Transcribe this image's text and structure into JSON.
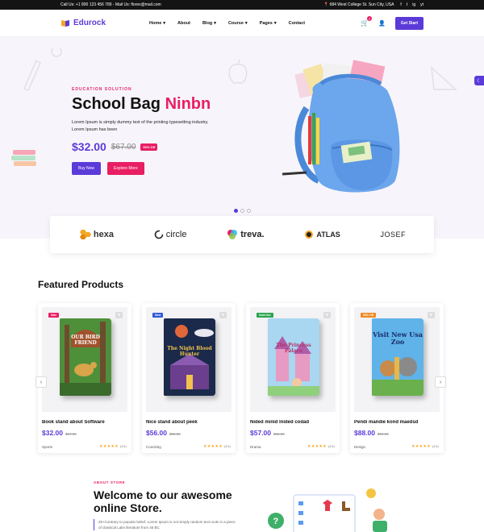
{
  "topbar": {
    "contact": "Call Us: +1 800 123 456 789 - Mail Us: florex@mail.com",
    "address": "684 West College St. Sun City, USA",
    "social": [
      "f",
      "t",
      "ig",
      "yt"
    ]
  },
  "header": {
    "logo": "Edurock",
    "nav": [
      "Home",
      "About",
      "Blog",
      "Course",
      "Pages",
      "Contact"
    ],
    "cart_count": "0",
    "cta": "Get Start"
  },
  "hero": {
    "eyebrow": "EDUCATION SOLUTION",
    "title_main": "School Bag",
    "title_accent": "Ninbn",
    "description": "Lorem Ipsum is simply dummy text of the printing typesetting industry. Lorem Ipsum has been",
    "price": "$32.00",
    "old_price": "$67.00",
    "discount": "50% Off",
    "buy_label": "Buy Now",
    "explore_label": "Explore More",
    "slides": 3,
    "active_slide": 1
  },
  "brands": [
    "hexa",
    "circle",
    "treva.",
    "ATLAS",
    "JOSEF"
  ],
  "featured": {
    "title": "Featured Products",
    "products": [
      {
        "tag": "Sale",
        "tag_color": "#e91e63",
        "book_title": "OUR BIRD FRIEND",
        "title": "Book stand about Software",
        "price": "$32.00",
        "old_price": "$67.00",
        "category": "Sports",
        "rating": "★★★★★",
        "reviews": "(44)"
      },
      {
        "tag": "New",
        "tag_color": "#2f5bd8",
        "book_title": "The Night Blood Hunter",
        "title": "Nice stand about peek",
        "price": "$56.00",
        "old_price": "$95.00",
        "category": "Coocking",
        "rating": "★★★★★",
        "reviews": "(44)"
      },
      {
        "tag": "Sold Out",
        "tag_color": "#2aa44f",
        "book_title": "The Princess Palace",
        "title": "Nided minid lnided codad",
        "price": "$57.00",
        "old_price": "$86.00",
        "category": "Drama",
        "rating": "★★★★★",
        "reviews": "(44)"
      },
      {
        "tag": "30% Off",
        "tag_color": "#f08a24",
        "book_title": "Visit New Usa Zoo",
        "title": "Pendi mandie kond maedsd",
        "price": "$88.00",
        "old_price": "$99.00",
        "category": "Design",
        "rating": "★★★★★",
        "reviews": "(44)"
      }
    ]
  },
  "about": {
    "eyebrow": "ABOUT STORE",
    "title": "Welcome to our awesome online Store.",
    "description": "25+Contrary to popular belief, Lorem Ipsum is not simply random text roots in a piece of classical Latin literature from 45 BC"
  },
  "colors": {
    "primary": "#5b3bd8",
    "accent": "#e91e63"
  }
}
